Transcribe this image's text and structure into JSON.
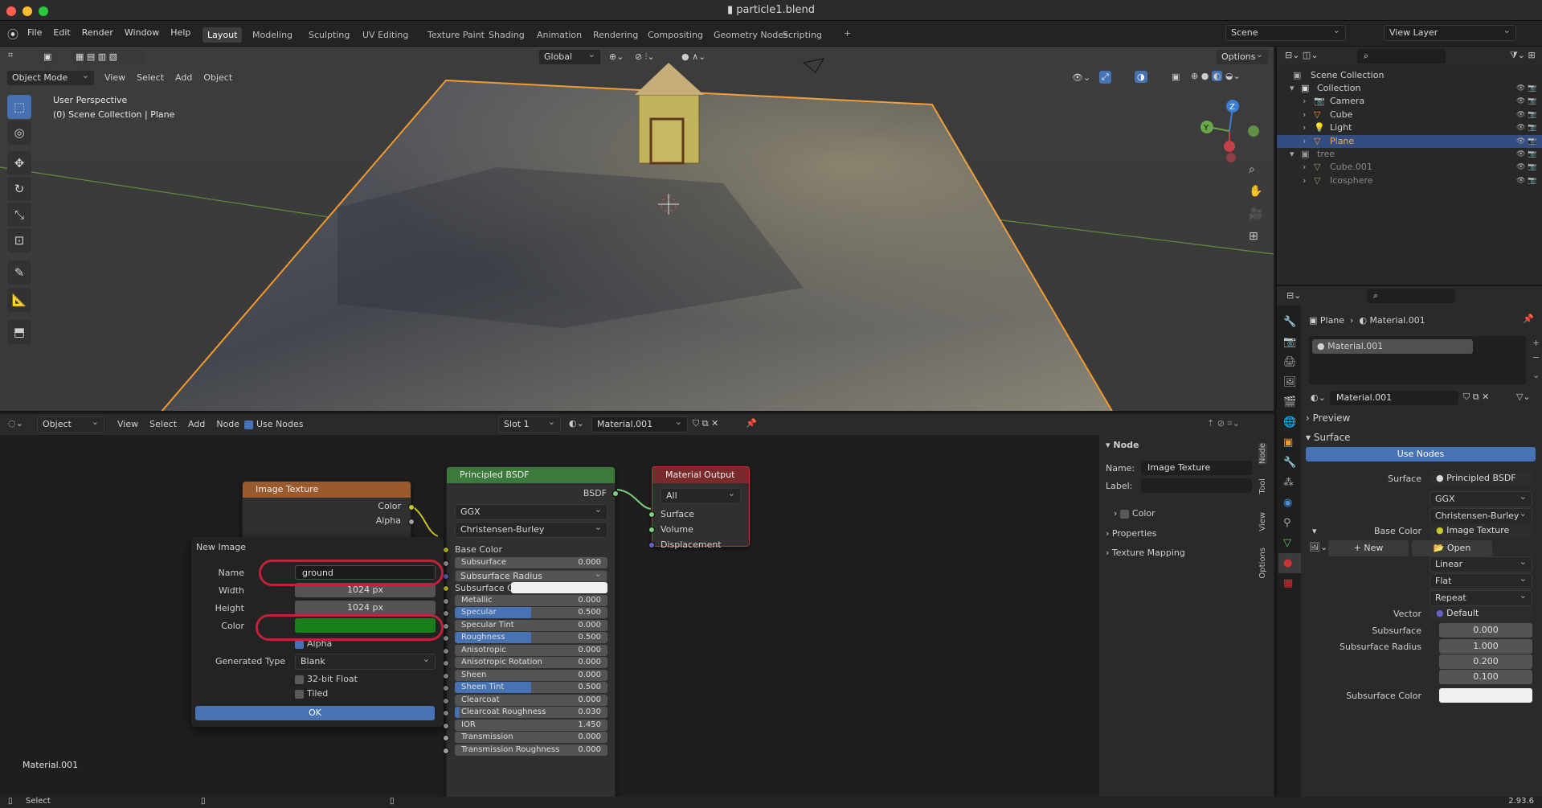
{
  "title": "particle1.blend",
  "menu": [
    "File",
    "Edit",
    "Render",
    "Window",
    "Help"
  ],
  "workspaces": [
    "Layout",
    "Modeling",
    "Sculpting",
    "UV Editing",
    "Texture Paint",
    "Shading",
    "Animation",
    "Rendering",
    "Compositing",
    "Geometry Nodes",
    "Scripting"
  ],
  "active_workspace": "Layout",
  "scene_label": "Scene",
  "view_layer_label": "View Layer",
  "viewport": {
    "mode": "Object Mode",
    "menus": [
      "View",
      "Select",
      "Add",
      "Object"
    ],
    "transform_orientation": "Global",
    "options_label": "Options",
    "overlay_line1": "User Perspective",
    "overlay_line2": "(0) Scene Collection | Plane",
    "axes": {
      "z": "Z",
      "y": "Y"
    }
  },
  "outliner": {
    "root": "Scene Collection",
    "items": [
      {
        "name": "Collection"
      },
      {
        "name": "Camera"
      },
      {
        "name": "Cube"
      },
      {
        "name": "Light"
      },
      {
        "name": "Plane"
      },
      {
        "name": "tree"
      },
      {
        "name": "Cube.001"
      },
      {
        "name": "Icosphere"
      }
    ]
  },
  "node_editor": {
    "mode": "Object",
    "menus": [
      "View",
      "Select",
      "Add",
      "Node"
    ],
    "use_nodes_label": "Use Nodes",
    "slot": "Slot 1",
    "material": "Material.001",
    "footer_label": "Material.001",
    "image_texture_node": {
      "title": "Image Texture",
      "out_color": "Color",
      "out_alpha": "Alpha"
    },
    "bsdf_node": {
      "title": "Principled BSDF",
      "out": "BSDF",
      "distribution": "GGX",
      "subsurface_method": "Christensen-Burley",
      "base_color": "Base Color",
      "rows": [
        {
          "label": "Subsurface",
          "value": "0.000",
          "fill": 0
        },
        {
          "label": "Subsurface Radius",
          "value": "",
          "fill": 0
        },
        {
          "label": "Subsurface C...",
          "value": "",
          "fill": 0
        },
        {
          "label": "Metallic",
          "value": "0.000",
          "fill": 0
        },
        {
          "label": "Specular",
          "value": "0.500",
          "fill": 50
        },
        {
          "label": "Specular Tint",
          "value": "0.000",
          "fill": 0
        },
        {
          "label": "Roughness",
          "value": "0.500",
          "fill": 50
        },
        {
          "label": "Anisotropic",
          "value": "0.000",
          "fill": 0
        },
        {
          "label": "Anisotropic Rotation",
          "value": "0.000",
          "fill": 0
        },
        {
          "label": "Sheen",
          "value": "0.000",
          "fill": 0
        },
        {
          "label": "Sheen Tint",
          "value": "0.500",
          "fill": 50
        },
        {
          "label": "Clearcoat",
          "value": "0.000",
          "fill": 0
        },
        {
          "label": "Clearcoat Roughness",
          "value": "0.030",
          "fill": 3
        },
        {
          "label": "IOR",
          "value": "1.450",
          "fill": 0
        },
        {
          "label": "Transmission",
          "value": "0.000",
          "fill": 0
        },
        {
          "label": "Transmission Roughness",
          "value": "0.000",
          "fill": 0
        }
      ]
    },
    "output_node": {
      "title": "Material Output",
      "target": "All",
      "inputs": [
        "Surface",
        "Volume",
        "Displacement"
      ]
    }
  },
  "new_image_dialog": {
    "title": "New Image",
    "name_label": "Name",
    "name_value": "ground",
    "width_label": "Width",
    "width_value": "1024 px",
    "height_label": "Height",
    "height_value": "1024 px",
    "color_label": "Color",
    "color_hex": "#1a7f1a",
    "alpha_label": "Alpha",
    "generated_type_label": "Generated Type",
    "generated_type_value": "Blank",
    "float_label": "32-bit Float",
    "tiled_label": "Tiled",
    "ok_label": "OK"
  },
  "node_sidebar": {
    "section": "Node",
    "name_label": "Name:",
    "name_value": "Image Texture",
    "label_label": "Label:",
    "color_label": "Color",
    "properties_label": "Properties",
    "texture_mapping_label": "Texture Mapping",
    "tabs": [
      "Node",
      "Tool",
      "View",
      "Options"
    ]
  },
  "properties": {
    "breadcrumb_object": "Plane",
    "breadcrumb_material": "Material.001",
    "slot_item": "Material.001",
    "material_field": "Material.001",
    "preview_label": "Preview",
    "surface_section": "Surface",
    "use_nodes_label": "Use Nodes",
    "surface_label": "Surface",
    "surface_value": "Principled BSDF",
    "distribution": "GGX",
    "subsurface_method": "Christensen-Burley",
    "base_color_label": "Base Color",
    "base_color_value": "Image Texture",
    "new_label": "New",
    "open_label": "Open",
    "interpolation": "Linear",
    "projection": "Flat",
    "extension": "Repeat",
    "vector_label": "Vector",
    "vector_value": "Default",
    "subsurface_label": "Subsurface",
    "subsurface_value": "0.000",
    "subsurface_radius_label": "Subsurface Radius",
    "subsurface_radius": [
      "1.000",
      "0.200",
      "0.100"
    ],
    "subsurface_color_label": "Subsurface Color"
  },
  "status": {
    "left": "Select",
    "version": "2.93.6"
  },
  "colors": {
    "accent": "#4772b3",
    "selection_orange": "#f29a2e",
    "highlight_red": "#c0223a"
  }
}
